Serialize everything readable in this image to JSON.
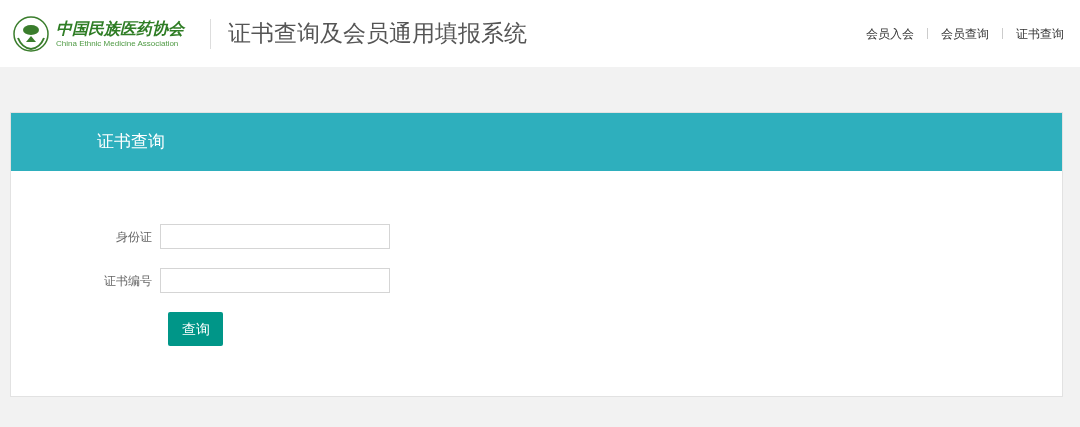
{
  "header": {
    "logo": {
      "name": "中国民族医药协会",
      "subtitle": "China Ethnic Medicine Association"
    },
    "title": "证书查询及会员通用填报系统",
    "nav": [
      {
        "label": "会员入会"
      },
      {
        "label": "会员查询"
      },
      {
        "label": "证书查询"
      }
    ]
  },
  "panel": {
    "title": "证书查询",
    "fields": [
      {
        "label": "身份证"
      },
      {
        "label": "证书编号"
      }
    ],
    "button": "查询"
  }
}
